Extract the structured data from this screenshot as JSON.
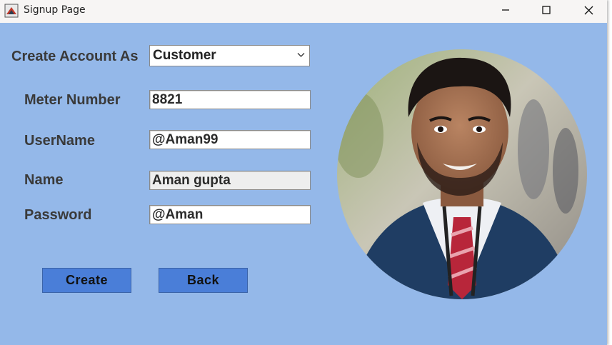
{
  "window": {
    "title": "Signup Page",
    "icons": {
      "app": "app-icon",
      "minimize": "minimize-icon",
      "maximize": "maximize-icon",
      "close": "close-icon"
    }
  },
  "form": {
    "account_type_label": "Create Account As",
    "account_type_value": "Customer",
    "meter_label": "Meter Number",
    "meter_value": "8821",
    "username_label": "UserName",
    "username_value": "@Aman99",
    "name_label": "Name",
    "name_value": "Aman gupta",
    "password_label": "Password",
    "password_value": "@Aman"
  },
  "buttons": {
    "create_label": "Create",
    "back_label": "Back"
  },
  "colors": {
    "background": "#94b8e9",
    "button": "#4a7ed8"
  }
}
